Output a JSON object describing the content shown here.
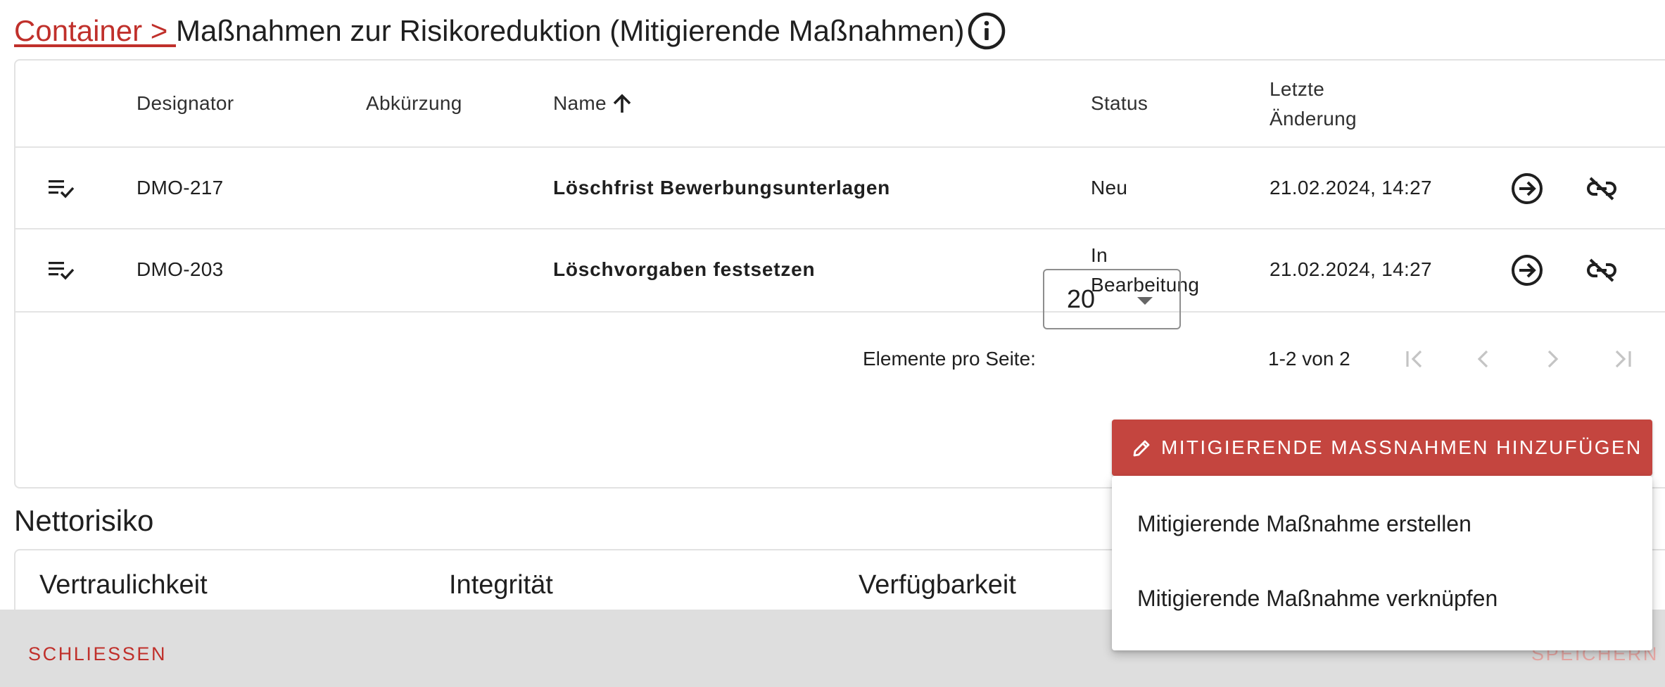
{
  "header": {
    "breadcrumb": "Container > ",
    "title": "Maßnahmen zur Risikoreduktion (Mitigierende Maßnahmen)",
    "info_icon": "info-circle-icon"
  },
  "table": {
    "columns": {
      "designator": "Designator",
      "abbreviation": "Abkürzung",
      "name": "Name",
      "status": "Status",
      "last_change_line1": "Letzte",
      "last_change_line2": "Änderung"
    },
    "sort_icon": "arrow-up-icon",
    "rows": [
      {
        "designator": "DMO-217",
        "abbreviation": "",
        "name": "Löschfrist Bewerbungsunterlagen",
        "status_line1": "Neu",
        "status_line2": "",
        "last_change": "21.02.2024, 14:27",
        "row_icon": "playlist-check-icon",
        "open_icon": "arrow-right-circle-icon",
        "unlink_icon": "link-off-icon"
      },
      {
        "designator": "DMO-203",
        "abbreviation": "",
        "name": "Löschvorgaben festsetzen",
        "status_line1": "In",
        "status_line2": "Bearbeitung",
        "last_change": "21.02.2024, 14:27",
        "row_icon": "playlist-check-icon",
        "open_icon": "arrow-right-circle-icon",
        "unlink_icon": "link-off-icon"
      }
    ]
  },
  "paginator": {
    "items_per_page_label": "Elemente pro Seite:",
    "items_per_page_value": "20",
    "range_label": "1-2 von 2",
    "icons": [
      "first-page-icon",
      "chevron-left-icon",
      "chevron-right-icon",
      "last-page-icon"
    ]
  },
  "add_button": {
    "label": "MITIGIERENDE MASSNAHMEN HINZUFÜGEN",
    "icon": "pencil-icon"
  },
  "add_menu": {
    "items": [
      "Mitigierende Maßnahme erstellen",
      "Mitigierende Maßnahme verknüpfen"
    ]
  },
  "net_risk": {
    "title": "Nettorisiko",
    "columns": [
      "Vertraulichkeit",
      "Integrität",
      "Verfügbarkeit"
    ]
  },
  "footer": {
    "close_label": "SCHLIESSEN",
    "save_label": "SPEICHERN"
  },
  "colors": {
    "accent": "#c0302b",
    "button_bg": "#c4453f",
    "footer_bg": "#dedede",
    "disabled_text": "#e9a9a6"
  }
}
